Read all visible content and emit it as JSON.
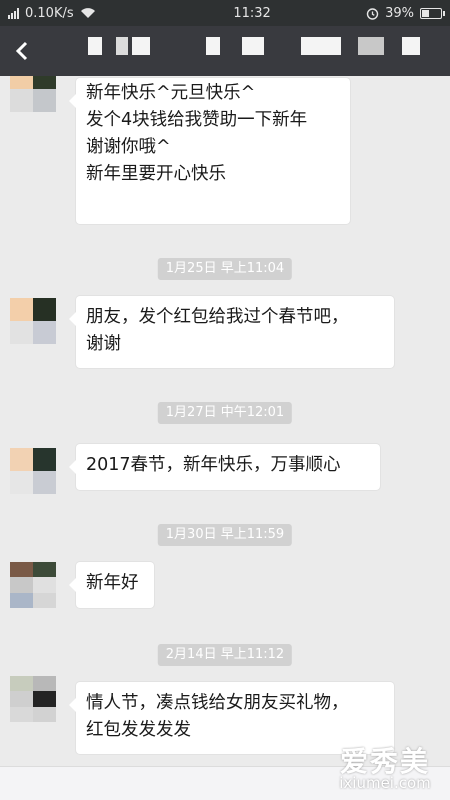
{
  "status_bar": {
    "network_speed": "0.10K/s",
    "time": "11:32",
    "battery": "39%",
    "battery_level": 0.39,
    "icons": [
      "signal-icon",
      "wifi-icon",
      "alarm-icon",
      "battery-icon"
    ]
  },
  "title_bar": {
    "back_icon": "back-arrow-icon",
    "title_obscured": true
  },
  "messages": [
    {
      "type": "message",
      "lines": [
        "新年快乐^元旦快乐^",
        "发个4块钱给我赞助一下新年",
        "谢谢你哦^",
        "新年里要开心快乐"
      ]
    },
    {
      "type": "timestamp",
      "text": "1月25日 早上11:04"
    },
    {
      "type": "message",
      "lines": [
        "朋友，发个红包给我过个春节吧，",
        "谢谢"
      ]
    },
    {
      "type": "timestamp",
      "text": "1月27日 中午12:01"
    },
    {
      "type": "message",
      "lines": [
        "2017春节，新年快乐，万事顺心"
      ]
    },
    {
      "type": "timestamp",
      "text": "1月30日 早上11:59"
    },
    {
      "type": "message",
      "lines": [
        "新年好"
      ]
    },
    {
      "type": "timestamp",
      "text": "2月14日 早上11:12"
    },
    {
      "type": "message",
      "lines": [
        "情人节，凑点钱给女朋友买礼物，",
        "红包发发发发"
      ]
    }
  ],
  "watermark": {
    "logo": "爱秀美",
    "url": "ixiumei.com"
  },
  "colors": {
    "status_bar_bg": "#2e3132",
    "title_bar_bg": "#393a3f",
    "chat_bg": "#ebebeb",
    "bubble_bg": "#ffffff",
    "timestamp_bg": "#d1d1d1"
  }
}
